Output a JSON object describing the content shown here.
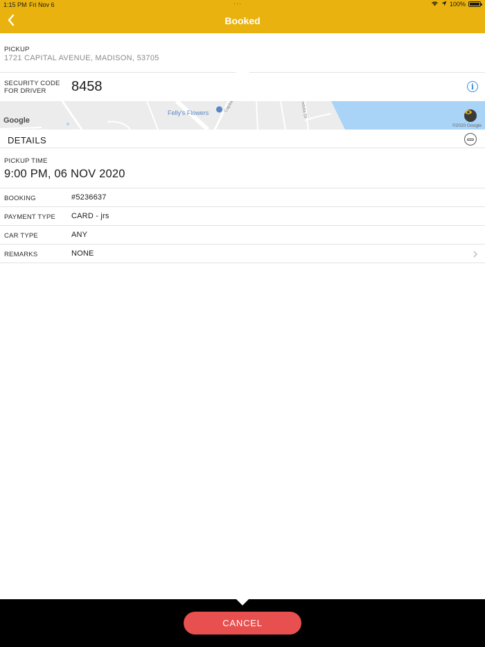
{
  "status_bar": {
    "time": "1:15 PM",
    "date": "Fri Nov 6",
    "battery": "100%"
  },
  "nav": {
    "title": "Booked"
  },
  "pickup": {
    "label": "PICKUP",
    "address": "1721 CAPITAL AVENUE, MADISON, 53705"
  },
  "security": {
    "label_line1": "SECURITY CODE",
    "label_line2": "FOR DRIVER",
    "code": "8458"
  },
  "map": {
    "logo": "Google",
    "place": "Felly's Flowers",
    "street": "Capital Ave",
    "street2": "ndota Dr",
    "copyright": "©2020 Google"
  },
  "details": {
    "title": "DETAILS",
    "pickup_time_label": "PICKUP TIME",
    "pickup_time_value": "9:00 PM, 06 NOV 2020",
    "rows": [
      {
        "label": "BOOKING",
        "value": "#5236637"
      },
      {
        "label": "PAYMENT TYPE",
        "value": "CARD - jrs"
      },
      {
        "label": "CAR TYPE",
        "value": "ANY"
      },
      {
        "label": "REMARKS",
        "value": "NONE"
      }
    ]
  },
  "actions": {
    "cancel_label": "CANCEL"
  },
  "colors": {
    "accent": "#e9b20e",
    "cancel": "#e8504f",
    "info": "#2f8ee0",
    "water": "#a9d3f7"
  },
  "icons": {
    "back": "chevron-left-icon",
    "info": "info-icon",
    "eye": "eye-icon",
    "collapse": "collapse-icon",
    "remarks": "chevron-right-icon"
  }
}
